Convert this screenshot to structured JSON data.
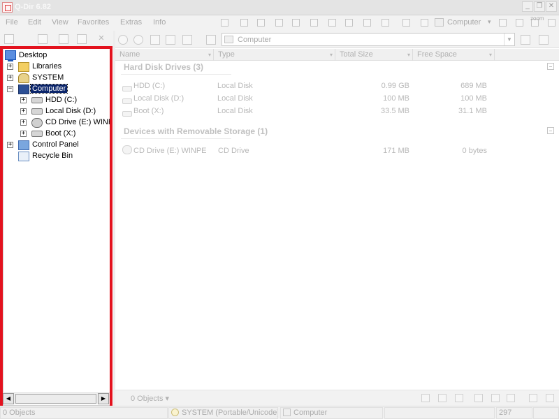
{
  "window": {
    "title": "Q-Dir 6.82",
    "minimize": "_",
    "restore": "❐",
    "close": "✕"
  },
  "menu": {
    "items": [
      "File",
      "Edit",
      "View",
      "Favorites",
      "Extras",
      "Info"
    ],
    "location": "Computer",
    "zoom_label": "zoom"
  },
  "address": {
    "path": "Computer"
  },
  "tree": {
    "items": [
      {
        "label": "Desktop",
        "icon": "desktop-icon"
      },
      {
        "label": "Libraries",
        "icon": "folder-icon"
      },
      {
        "label": "SYSTEM",
        "icon": "user-folder-icon"
      },
      {
        "label": "Computer",
        "icon": "computer-icon"
      },
      {
        "label": "HDD (C:)",
        "icon": "hard-drive-icon"
      },
      {
        "label": "Local Disk (D:)",
        "icon": "hard-drive-icon"
      },
      {
        "label": "CD Drive (E:) WINPE",
        "icon": "cd-drive-icon"
      },
      {
        "label": "Boot (X:)",
        "icon": "hard-drive-icon"
      },
      {
        "label": "Control Panel",
        "icon": "control-panel-icon"
      },
      {
        "label": "Recycle Bin",
        "icon": "recycle-bin-icon"
      }
    ],
    "expand_symbol": "+",
    "collapse_symbol": "−"
  },
  "list": {
    "columns": [
      "Name",
      "Type",
      "Total Size",
      "Free Space"
    ],
    "groups": [
      {
        "title": "Hard Disk Drives (3)",
        "rows": [
          {
            "name": "HDD (C:)",
            "type": "Local Disk",
            "total": "0.99 GB",
            "free": "689 MB"
          },
          {
            "name": "Local Disk (D:)",
            "type": "Local Disk",
            "total": "100 MB",
            "free": "100 MB"
          },
          {
            "name": "Boot (X:)",
            "type": "Local Disk",
            "total": "33.5 MB",
            "free": "31.1 MB"
          }
        ]
      },
      {
        "title": "Devices with Removable Storage (1)",
        "rows": [
          {
            "name": "CD Drive (E:) WINPE",
            "type": "CD Drive",
            "total": "171 MB",
            "free": "0 bytes"
          }
        ]
      }
    ],
    "footer_count": "0 Objects"
  },
  "status": {
    "objects": "0 Objects",
    "system": "SYSTEM (Portable/Unicode)",
    "location": "Computer",
    "number": "297"
  },
  "colors": {
    "highlight_frame": "#e3121e",
    "selection": "#0a246a"
  }
}
